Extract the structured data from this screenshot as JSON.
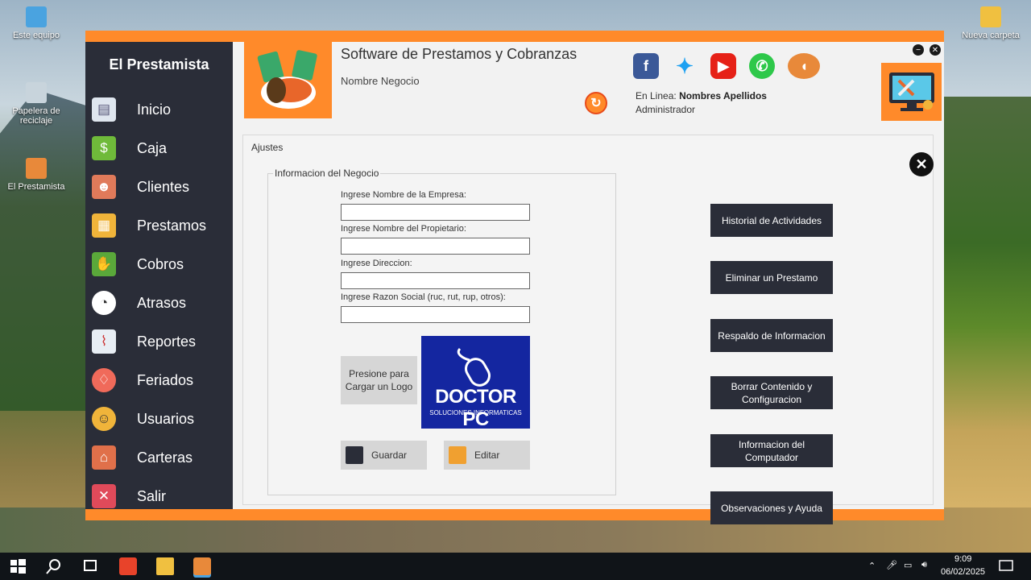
{
  "desktop": {
    "icons": [
      {
        "label": "Este equipo"
      },
      {
        "label": "Papelera de reciclaje"
      },
      {
        "label": "El Prestamista"
      },
      {
        "label": "Nueva carpeta"
      }
    ]
  },
  "sidebar": {
    "brand": "El Prestamista",
    "items": [
      {
        "label": "Inicio",
        "icon": "id-card-icon"
      },
      {
        "label": "Caja",
        "icon": "cash-register-icon"
      },
      {
        "label": "Clientes",
        "icon": "users-icon"
      },
      {
        "label": "Prestamos",
        "icon": "loan-icon"
      },
      {
        "label": "Cobros",
        "icon": "money-hand-icon"
      },
      {
        "label": "Atrasos",
        "icon": "clock-icon"
      },
      {
        "label": "Reportes",
        "icon": "report-icon"
      },
      {
        "label": "Feriados",
        "icon": "balloon-icon"
      },
      {
        "label": "Usuarios",
        "icon": "user-icon"
      },
      {
        "label": "Carteras",
        "icon": "house-icon"
      },
      {
        "label": "Salir",
        "icon": "exit-icon"
      }
    ]
  },
  "header": {
    "title": "Software de Prestamos y Cobranzas",
    "business_name": "Nombre Negocio",
    "online_prefix": "En Linea:",
    "online_user": "Nombres Apellidos",
    "role": "Administrador"
  },
  "content": {
    "section": "Ajustes",
    "group_title": "Informacion del Negocio",
    "fields": [
      {
        "label": "Ingrese Nombre de la Empresa:",
        "value": ""
      },
      {
        "label": "Ingrese Nombre del Propietario:",
        "value": ""
      },
      {
        "label": "Ingrese Direccion:",
        "value": ""
      },
      {
        "label": "Ingrese Razon Social (ruc, rut, rup, otros):",
        "value": ""
      }
    ],
    "load_logo": "Presione para Cargar un Logo",
    "logo_title": "DOCTOR PC",
    "logo_subtitle": "SOLUCIONES INFORMATICAS",
    "save_label": "Guardar",
    "edit_label": "Editar"
  },
  "actions": [
    "Historial de Actividades",
    "Eliminar un Prestamo",
    "Respaldo de Informacion",
    "Borrar Contenido y Configuracion",
    "Informacion del Computador",
    "Observaciones y Ayuda"
  ],
  "taskbar": {
    "time": "9:09",
    "date": "06/02/2025"
  },
  "colors": {
    "accent": "#ff8a2a",
    "sidebar": "#2a2d38",
    "logo_blue": "#1426a0"
  }
}
